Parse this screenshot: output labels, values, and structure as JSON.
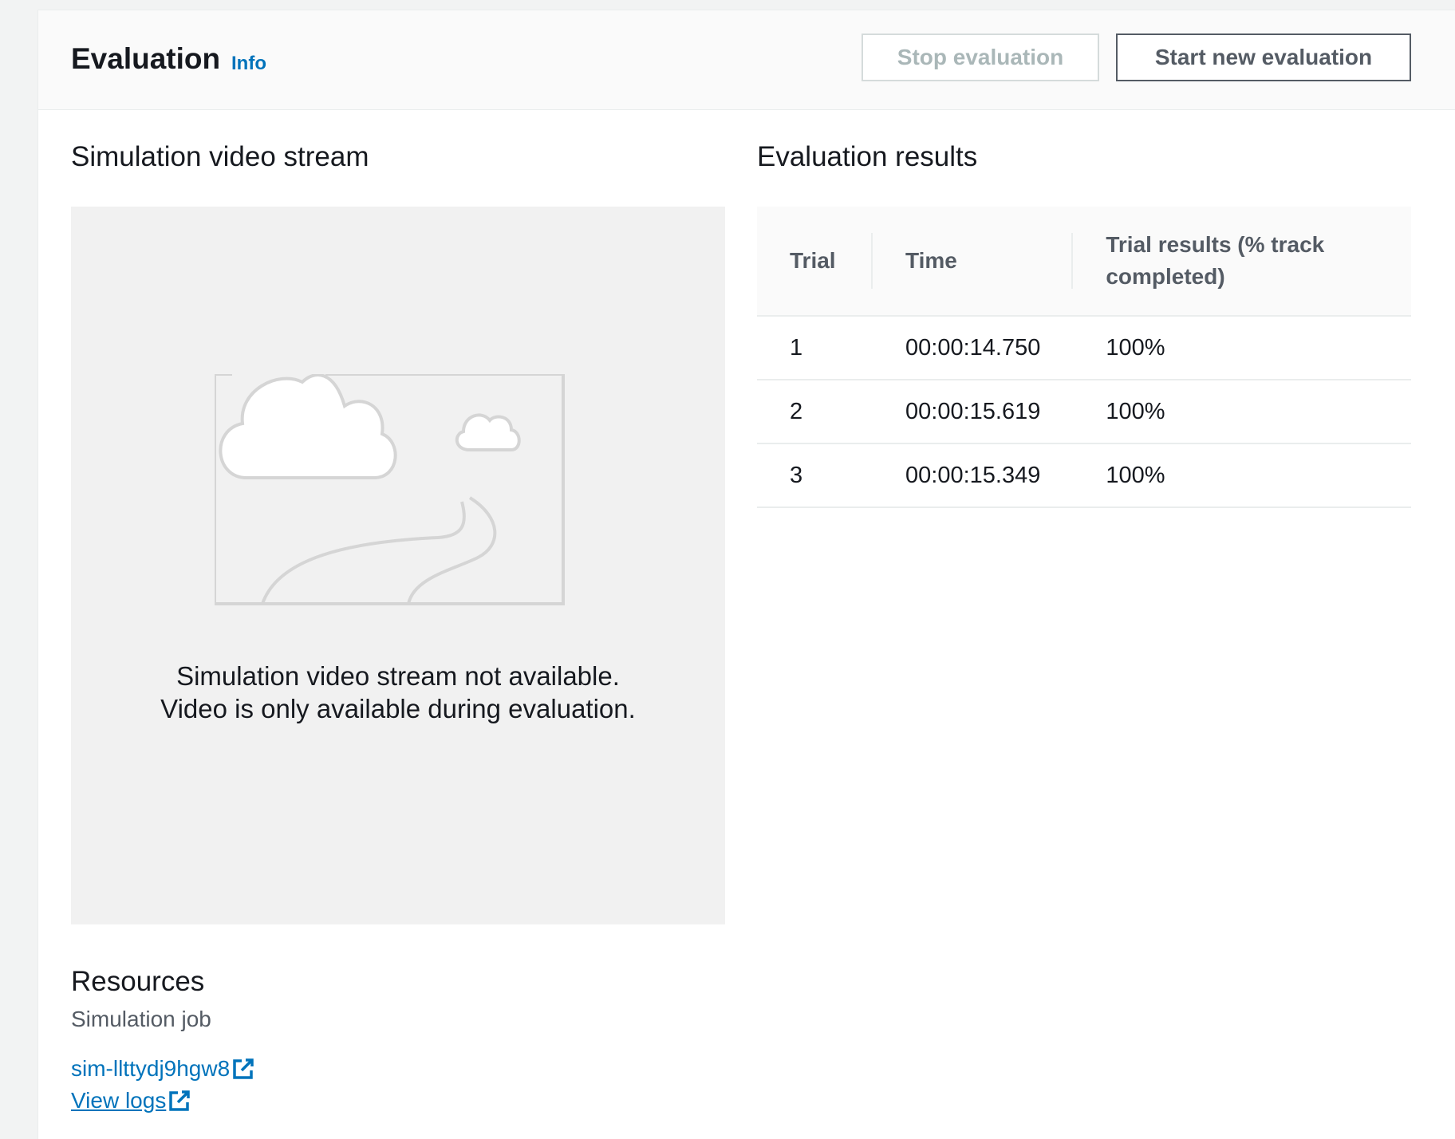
{
  "header": {
    "title": "Evaluation",
    "info_label": "Info",
    "stop_button": "Stop evaluation",
    "start_button": "Start new evaluation"
  },
  "video": {
    "title": "Simulation video stream",
    "message_line1": "Simulation video stream not available.",
    "message_line2": "Video is only available during evaluation."
  },
  "results": {
    "title": "Evaluation results",
    "columns": [
      "Trial",
      "Time",
      "Trial results (% track completed)"
    ],
    "rows": [
      {
        "trial": "1",
        "time": "00:00:14.750",
        "result": "100%"
      },
      {
        "trial": "2",
        "time": "00:00:15.619",
        "result": "100%"
      },
      {
        "trial": "3",
        "time": "00:00:15.349",
        "result": "100%"
      }
    ]
  },
  "resources": {
    "title": "Resources",
    "simulation_job_label": "Simulation job",
    "simulation_job_id": "sim-llttydj9hgw8",
    "view_logs": "View logs"
  },
  "colors": {
    "link": "#0073bb",
    "text": "#16191f",
    "muted": "#545b64",
    "disabled": "#aab7b8"
  },
  "icons": {
    "external": "external-link-icon",
    "placeholder": "image-placeholder-icon"
  }
}
